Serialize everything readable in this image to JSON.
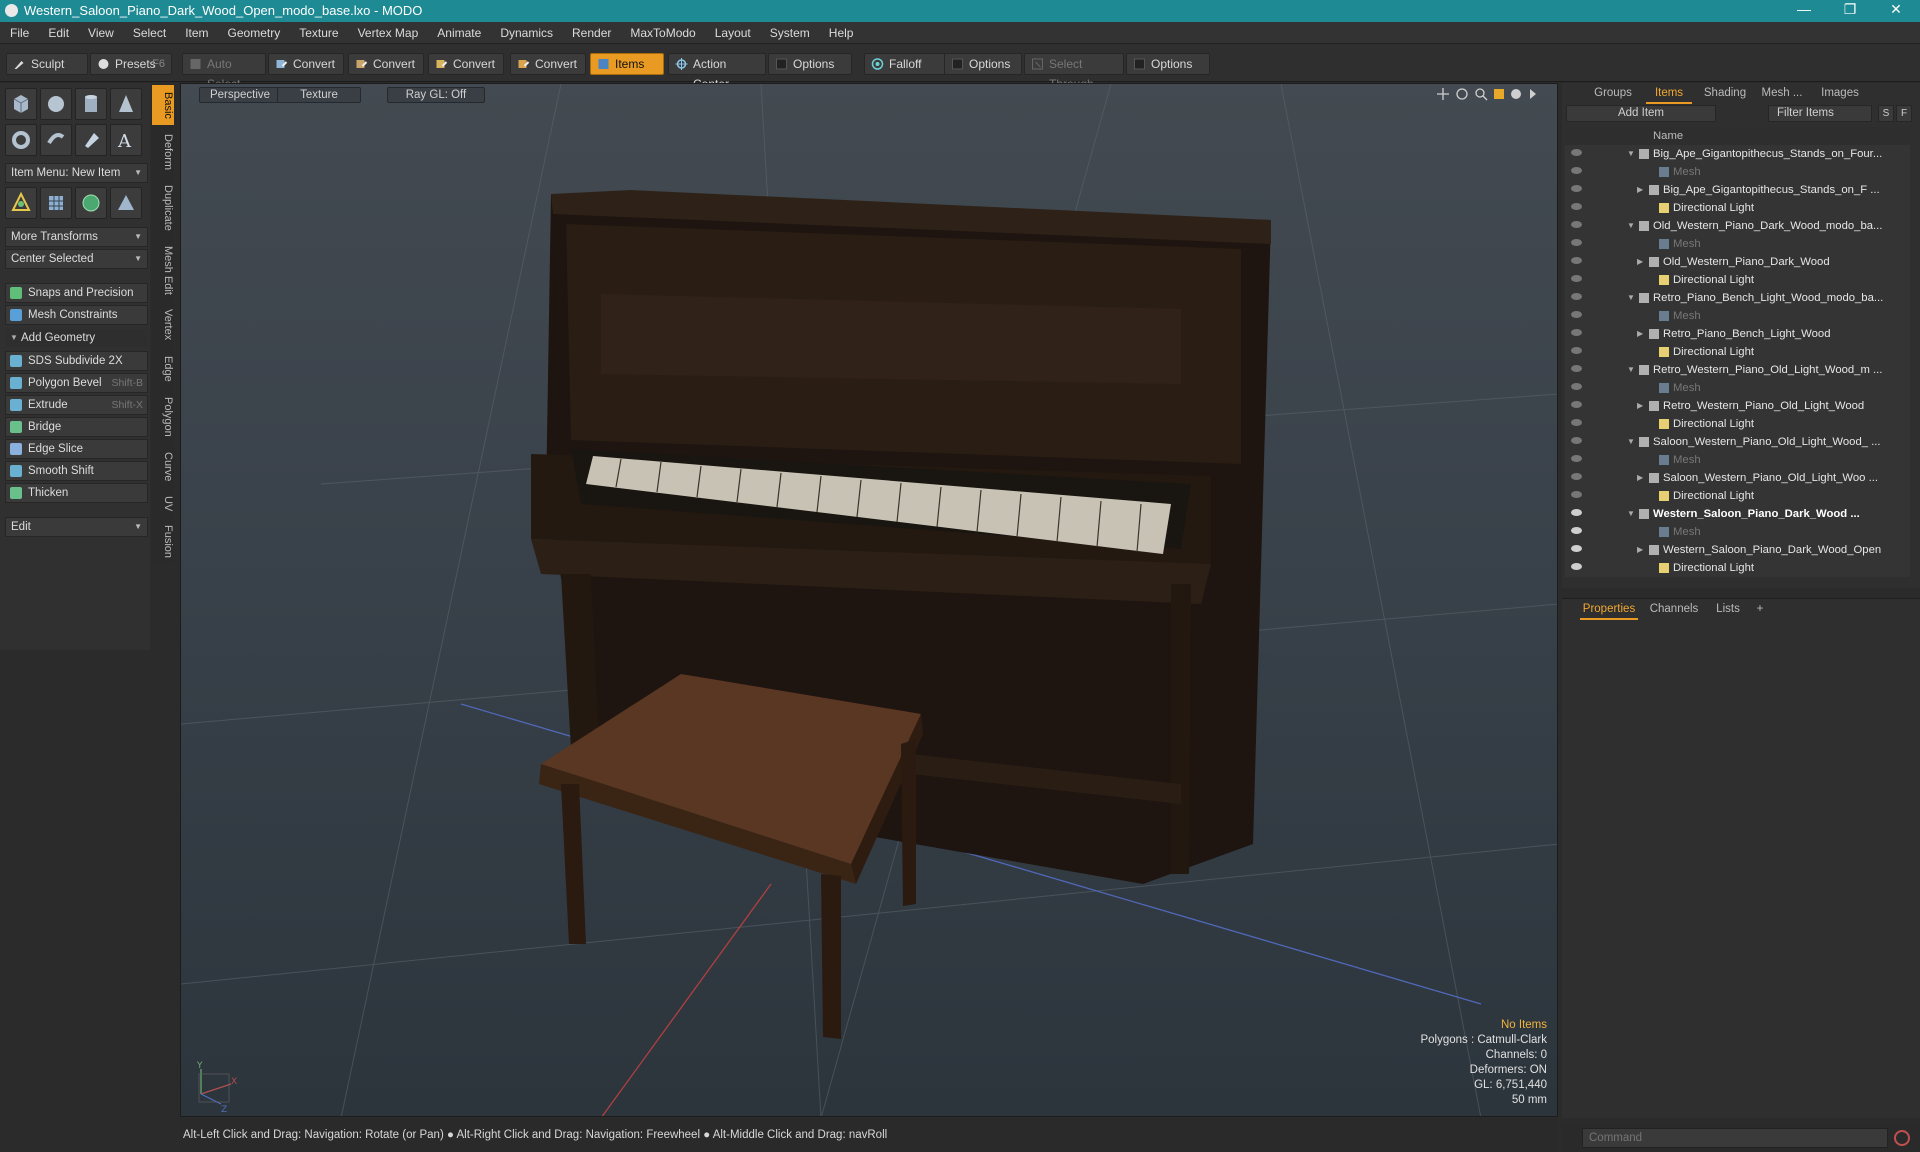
{
  "window": {
    "title": "Western_Saloon_Piano_Dark_Wood_Open_modo_base.lxo - MODO",
    "minimize": "—",
    "restore": "❐",
    "close": "✕"
  },
  "menu": [
    "File",
    "Edit",
    "View",
    "Select",
    "Item",
    "Geometry",
    "Texture",
    "Vertex Map",
    "Animate",
    "Dynamics",
    "Render",
    "MaxToModo",
    "Layout",
    "System",
    "Help"
  ],
  "toolbar": {
    "sculpt": "Sculpt",
    "presets": "Presets",
    "presets_shortcut": "F6",
    "auto_select": "Auto Select",
    "convert1": "Convert",
    "convert2": "Convert",
    "convert3": "Convert",
    "convert4": "Convert",
    "items": "Items",
    "action_center": "Action Center",
    "options1": "Options",
    "falloff": "Falloff",
    "options2": "Options",
    "select_through": "Select Through",
    "options3": "Options"
  },
  "left_panel": {
    "item_menu": "Item Menu: New Item",
    "more_transforms": "More Transforms",
    "center_selected": "Center Selected",
    "snaps": "Snaps and Precision",
    "mesh_constraints": "Mesh Constraints",
    "add_geometry": "Add Geometry",
    "tools": [
      {
        "label": "SDS Subdivide 2X",
        "shortcut": ""
      },
      {
        "label": "Polygon Bevel",
        "shortcut": "Shift-B"
      },
      {
        "label": "Extrude",
        "shortcut": "Shift-X"
      },
      {
        "label": "Bridge",
        "shortcut": ""
      },
      {
        "label": "Edge Slice",
        "shortcut": ""
      },
      {
        "label": "Smooth Shift",
        "shortcut": ""
      },
      {
        "label": "Thicken",
        "shortcut": ""
      }
    ],
    "edit": "Edit",
    "vtabs": [
      "Basic",
      "Deform",
      "Duplicate",
      "Mesh Edit",
      "Vertex",
      "Edge",
      "Polygon",
      "Curve",
      "UV",
      "Fusion"
    ]
  },
  "viewport": {
    "view_mode": "Perspective",
    "shading": "Texture",
    "raygl": "Ray GL: Off",
    "info": {
      "selection": "No Items",
      "polygons": "Polygons : Catmull-Clark",
      "channels": "Channels: 0",
      "deformers": "Deformers: ON",
      "gl": "GL: 6,751,440",
      "focal": "50 mm"
    },
    "axis_x": "X",
    "axis_y": "Y",
    "axis_z": "Z"
  },
  "status_bar": "Alt-Left Click and Drag: Navigation: Rotate (or Pan) ● Alt-Right Click and Drag: Navigation: Freewheel ● Alt-Middle Click and Drag: navRoll",
  "items_panel": {
    "tabs": [
      "Groups",
      "Items",
      "Shading",
      "Mesh ...",
      "Images"
    ],
    "add_item": "Add Item",
    "filter_items": "Filter Items",
    "s_btn": "S",
    "f_btn": "F",
    "name_col": "Name",
    "rows": [
      {
        "label": "Big_Ape_Gigantopithecus_Stands_on_Four...",
        "level": 0,
        "kind": "scene"
      },
      {
        "label": "Mesh",
        "level": 2,
        "kind": "mesh"
      },
      {
        "label": "Big_Ape_Gigantopithecus_Stands_on_F ...",
        "level": 1,
        "kind": "item"
      },
      {
        "label": "Directional Light",
        "level": 2,
        "kind": "light"
      },
      {
        "label": "Old_Western_Piano_Dark_Wood_modo_ba...",
        "level": 0,
        "kind": "scene"
      },
      {
        "label": "Mesh",
        "level": 2,
        "kind": "mesh"
      },
      {
        "label": "Old_Western_Piano_Dark_Wood",
        "level": 1,
        "kind": "item"
      },
      {
        "label": "Directional Light",
        "level": 2,
        "kind": "light"
      },
      {
        "label": "Retro_Piano_Bench_Light_Wood_modo_ba...",
        "level": 0,
        "kind": "scene"
      },
      {
        "label": "Mesh",
        "level": 2,
        "kind": "mesh"
      },
      {
        "label": "Retro_Piano_Bench_Light_Wood",
        "level": 1,
        "kind": "item"
      },
      {
        "label": "Directional Light",
        "level": 2,
        "kind": "light"
      },
      {
        "label": "Retro_Western_Piano_Old_Light_Wood_m ...",
        "level": 0,
        "kind": "scene"
      },
      {
        "label": "Mesh",
        "level": 2,
        "kind": "mesh"
      },
      {
        "label": "Retro_Western_Piano_Old_Light_Wood",
        "level": 1,
        "kind": "item"
      },
      {
        "label": "Directional Light",
        "level": 2,
        "kind": "light"
      },
      {
        "label": "Saloon_Western_Piano_Old_Light_Wood_ ...",
        "level": 0,
        "kind": "scene"
      },
      {
        "label": "Mesh",
        "level": 2,
        "kind": "mesh"
      },
      {
        "label": "Saloon_Western_Piano_Old_Light_Woo ...",
        "level": 1,
        "kind": "item"
      },
      {
        "label": "Directional Light",
        "level": 2,
        "kind": "light"
      },
      {
        "label": "Western_Saloon_Piano_Dark_Wood ...",
        "level": 0,
        "kind": "scene",
        "bold": true
      },
      {
        "label": "Mesh",
        "level": 2,
        "kind": "mesh"
      },
      {
        "label": "Western_Saloon_Piano_Dark_Wood_Open",
        "level": 1,
        "kind": "item"
      },
      {
        "label": "Directional Light",
        "level": 2,
        "kind": "light"
      }
    ]
  },
  "props_panel": {
    "tabs": [
      "Properties",
      "Channels",
      "Lists"
    ],
    "add": "+"
  },
  "command": {
    "placeholder": "Command"
  },
  "colors": {
    "accent": "#e89a22",
    "titlebar": "#1e8a93",
    "info_highlight": "#f0b43c"
  }
}
